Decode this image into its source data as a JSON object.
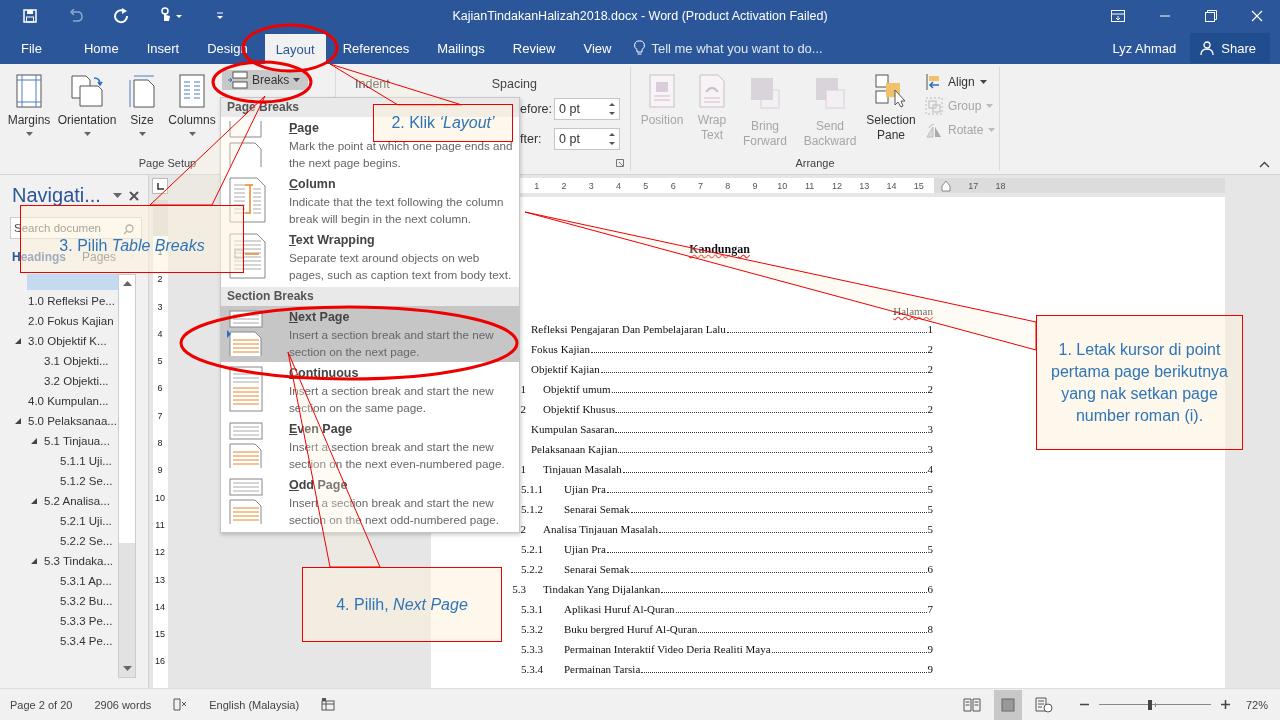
{
  "window": {
    "title": "KajianTindakanHalizah2018.docx - Word (Product Activation Failed)"
  },
  "tabs": [
    {
      "label": "File",
      "selected": false
    },
    {
      "label": "Home",
      "selected": false
    },
    {
      "label": "Insert",
      "selected": false
    },
    {
      "label": "Design",
      "selected": false
    },
    {
      "label": "Layout",
      "selected": true
    },
    {
      "label": "References",
      "selected": false
    },
    {
      "label": "Mailings",
      "selected": false
    },
    {
      "label": "Review",
      "selected": false
    },
    {
      "label": "View",
      "selected": false
    }
  ],
  "tell_me": {
    "placeholder": "Tell me what you want to do..."
  },
  "user": "Lyz Ahmad",
  "share_button": "Share",
  "ribbon": {
    "page_setup": {
      "label": "Page Setup",
      "buttons": [
        {
          "kind": "margins",
          "label": "Margins"
        },
        {
          "kind": "orientation",
          "label": "Orientation"
        },
        {
          "kind": "size",
          "label": "Size"
        },
        {
          "kind": "columns",
          "label": "Columns"
        }
      ],
      "breaks_button": "Breaks"
    },
    "paragraph": {
      "indent_label": "Indent",
      "spacing_label": "Spacing",
      "fields": [
        {
          "label": "efore:",
          "value": "0 pt"
        },
        {
          "label": "fter:",
          "value": "0 pt"
        }
      ]
    },
    "arrange": {
      "label": "Arrange",
      "large": [
        {
          "kind": "position",
          "label": "Position",
          "disabled": true
        },
        {
          "kind": "wrap",
          "label": "Wrap Text",
          "disabled": true
        },
        {
          "kind": "forward",
          "label": "Bring Forward",
          "disabled": true
        },
        {
          "kind": "backward",
          "label": "Send Backward",
          "disabled": true
        },
        {
          "kind": "selection",
          "label": "Selection Pane",
          "disabled": false
        }
      ],
      "small": [
        {
          "kind": "align",
          "label": "Align",
          "disabled": false
        },
        {
          "kind": "group",
          "label": "Group",
          "disabled": true
        },
        {
          "kind": "rotate",
          "label": "Rotate",
          "disabled": true
        }
      ]
    }
  },
  "breaks_menu": {
    "sections": [
      {
        "heading": "Page Breaks",
        "items": [
          {
            "kind": "page",
            "title": "Page",
            "description": "Mark the point at which one page ends and the next page begins.",
            "selected": false
          },
          {
            "kind": "column",
            "title": "Column",
            "description": "Indicate that the text following the column break will begin in the next column.",
            "selected": false
          },
          {
            "kind": "wrapping",
            "title": "Text Wrapping",
            "description": "Separate text around objects on web pages, such as caption text from body text.",
            "selected": false
          }
        ]
      },
      {
        "heading": "Section Breaks",
        "items": [
          {
            "kind": "next",
            "title": "Next Page",
            "description": "Insert a section break and start the new section on the next page.",
            "selected": true
          },
          {
            "kind": "continuous",
            "title": "Continuous",
            "description": "Insert a section break and start the new section on the same page.",
            "selected": false
          },
          {
            "kind": "even",
            "title": "Even Page",
            "description": "Insert a section break and start the new section on the next even-numbered page.",
            "selected": false
          },
          {
            "kind": "odd",
            "title": "Odd Page",
            "description": "Insert a section break and start the new section on the next odd-numbered page.",
            "selected": false
          }
        ]
      }
    ]
  },
  "navigation": {
    "title": "Navigati...",
    "search": {
      "placeholder": "Search documen"
    },
    "tabs": [
      {
        "label": "Headings",
        "selected": true
      },
      {
        "label": "Pages",
        "selected": false
      }
    ],
    "headings": [
      {
        "label": "1.0 Refleksi Pe..."
      },
      {
        "label": "2.0 Fokus Kajian"
      },
      {
        "label": "3.0 Objektif K...",
        "expanded": true,
        "children": [
          {
            "label": "3.1 Objekti..."
          },
          {
            "label": "3.2 Objekti..."
          }
        ]
      },
      {
        "label": "4.0 Kumpulan..."
      },
      {
        "label": "5.0 Pelaksanaa...",
        "expanded": true,
        "children": [
          {
            "label": "5.1 Tinjaua...",
            "expanded": true,
            "children": [
              {
                "label": "5.1.1 Uji..."
              },
              {
                "label": "5.1.2 Se..."
              }
            ]
          },
          {
            "label": "5.2 Analisa...",
            "expanded": true,
            "children": [
              {
                "label": "5.2.1 Uji..."
              },
              {
                "label": "5.2.2 Se..."
              }
            ]
          },
          {
            "label": "5.3 Tindaka...",
            "expanded": true,
            "children": [
              {
                "label": "5.3.1 Ap..."
              },
              {
                "label": "5.3.2 Bu..."
              },
              {
                "label": "5.3.3 Pe..."
              },
              {
                "label": "5.3.4 Pe..."
              }
            ]
          }
        ]
      }
    ]
  },
  "ruler": {
    "horizontal": [
      "1",
      "2",
      "3",
      "4",
      "5",
      "6",
      "7",
      "8",
      "9",
      "10",
      "11",
      "12",
      "13",
      "14",
      "15",
      "17",
      "18"
    ],
    "vertical": [
      "1",
      "2",
      "3",
      "4",
      "5",
      "6",
      "7",
      "8",
      "9",
      "10",
      "11",
      "12",
      "13",
      "14",
      "15",
      "16"
    ]
  },
  "document": {
    "title": "Kandungan",
    "page_label": "Halaman",
    "toc": [
      {
        "kind": "top",
        "text": "Refleksi Pengajaran Dan Pembelajaran Lalu",
        "page": "1"
      },
      {
        "kind": "top",
        "text": "Fokus Kajian",
        "page": "2"
      },
      {
        "kind": "top",
        "text": "Objektif Kajian",
        "page": "2"
      },
      {
        "kind": "sub",
        "number": "1",
        "text": "Objektif umum",
        "page": "2"
      },
      {
        "kind": "sub",
        "number": "2",
        "text": "Objektif Khusus",
        "page": "2"
      },
      {
        "kind": "top",
        "text": "Kumpulan Sasaran",
        "page": "3"
      },
      {
        "kind": "top",
        "text": "Pelaksanaan Kajian",
        "page": "3"
      },
      {
        "kind": "sub",
        "number": "1",
        "text": "Tinjauan Masalah",
        "page": "4"
      },
      {
        "kind": "subsub",
        "number": "5.1.1",
        "text": "Ujian Pra",
        "page": "5"
      },
      {
        "kind": "subsub",
        "number": "5.1.2",
        "text": "Senarai Semak",
        "page": "5"
      },
      {
        "kind": "sub",
        "number": "2",
        "text": "Analisa Tinjauan Masalah",
        "page": "5"
      },
      {
        "kind": "subsub",
        "number": "5.2.1",
        "text": "Ujian Pra",
        "page": "5"
      },
      {
        "kind": "subsub",
        "number": "5.2.2",
        "text": "Senarai Semak",
        "page": "6"
      },
      {
        "kind": "sub",
        "number": "5.3",
        "text": "Tindakan Yang Dijalankan",
        "page": "6"
      },
      {
        "kind": "subsub",
        "number": "5.3.1",
        "text": "Aplikasi Huruf Al-Quran",
        "page": "7"
      },
      {
        "kind": "subsub",
        "number": "5.3.2",
        "text": "Buku bergred Huruf Al-Quran",
        "page": "8"
      },
      {
        "kind": "subsub",
        "number": "5.3.3",
        "text": "Permainan Interaktif Video Deria Realiti Maya",
        "page": "9"
      },
      {
        "kind": "subsub",
        "number": "5.3.4",
        "text": "Permainan Tarsia",
        "page": "9"
      }
    ]
  },
  "status_bar": {
    "page": "Page 2 of 20",
    "words": "2906 words",
    "language": "English (Malaysia)",
    "views": [
      {
        "kind": "read",
        "selected": false
      },
      {
        "kind": "print",
        "selected": true
      },
      {
        "kind": "web",
        "selected": false
      }
    ],
    "zoom": {
      "level": 0.46,
      "reading": "72%"
    }
  },
  "callouts": [
    {
      "text": "1. Letak kursor di point pertama page berikutnya yang nak setkan page number roman (i)."
    },
    {
      "text": "2. Klik *‘Layout’*"
    },
    {
      "text": "3. Pilih *Table Breaks*"
    },
    {
      "text": "4. Pilih, *Next Page*"
    }
  ]
}
